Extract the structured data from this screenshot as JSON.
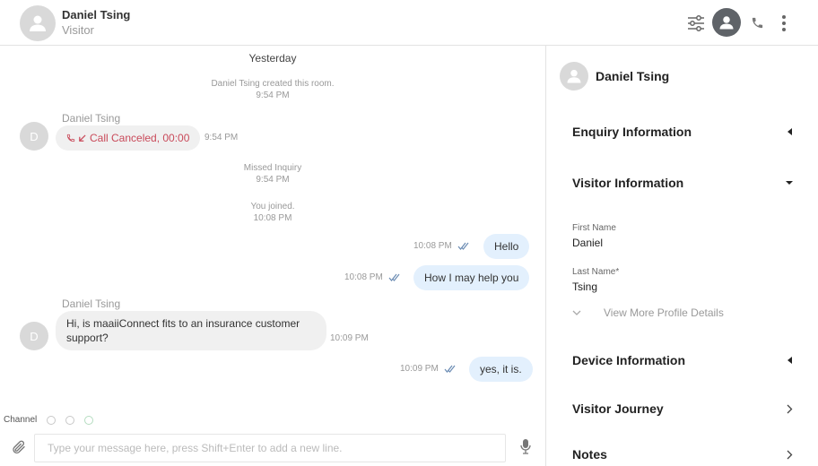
{
  "header": {
    "contact_name": "Daniel Tsing",
    "contact_role": "Visitor"
  },
  "chat": {
    "day_label": "Yesterday",
    "room_created": {
      "text": "Daniel Tsing created this room.",
      "time": "9:54 PM"
    },
    "call_message": {
      "sender": "Daniel Tsing",
      "avatar_initial": "D",
      "text": "Call Canceled, 00:00",
      "time": "9:54 PM"
    },
    "missed_inquiry": {
      "text": "Missed Inquiry",
      "time": "9:54 PM"
    },
    "you_joined": {
      "text": "You joined.",
      "time": "10:08 PM"
    },
    "out_1": {
      "text": "Hello",
      "time": "10:08 PM"
    },
    "out_2": {
      "text": "How I may help you",
      "time": "10:08 PM"
    },
    "in_1": {
      "sender": "Daniel Tsing",
      "avatar_initial": "D",
      "line1": "Hi, is maaiiConnect fits to an insurance customer",
      "line2": "support?",
      "time": "10:09 PM"
    },
    "out_3": {
      "text": "yes, it is.",
      "time": "10:09 PM"
    }
  },
  "composer": {
    "channel_label": "Channel",
    "placeholder": "Type your message here, press Shift+Enter to add a new line.",
    "value": ""
  },
  "side_panel": {
    "contact_name": "Daniel Tsing",
    "sections": {
      "enquiry": "Enquiry Information",
      "visitor": "Visitor Information",
      "device": "Device Information",
      "journey": "Visitor Journey",
      "notes": "Notes"
    },
    "fields": {
      "first_name_label": "First Name",
      "first_name_value": "Daniel",
      "last_name_label": "Last Name*",
      "last_name_value": "Tsing"
    },
    "view_more": "View More Profile Details"
  },
  "icons": {
    "avatar": "person-icon",
    "filter": "sliders-icon",
    "phone": "phone-icon",
    "more": "kebab-icon",
    "read": "double-check-icon",
    "attach": "paperclip-icon",
    "mic": "microphone-icon"
  },
  "colors": {
    "outgoing_bubble": "#e3f0fd",
    "incoming_bubble": "#f0f0f0",
    "call_canceled": "#c94a5a",
    "read_receipt": "#6a8bb3"
  }
}
